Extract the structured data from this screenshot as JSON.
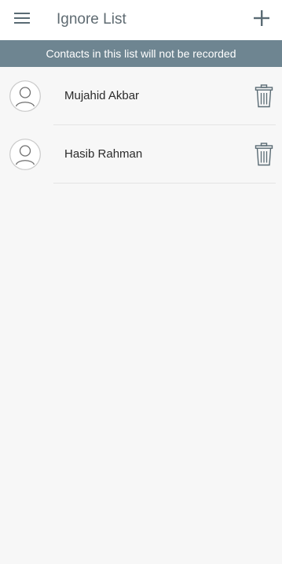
{
  "app_bar": {
    "title": "Ignore List",
    "menu_icon": "hamburger-menu-icon",
    "add_icon": "plus-icon"
  },
  "banner": {
    "text": "Contacts in this list will not be recorded"
  },
  "contacts": [
    {
      "name": "Mujahid Akbar",
      "avatar_icon": "person-avatar-icon",
      "delete_icon": "trash-icon"
    },
    {
      "name": "Hasib Rahman",
      "avatar_icon": "person-avatar-icon",
      "delete_icon": "trash-icon"
    }
  ],
  "colors": {
    "banner_background": "#6e8591",
    "title_text": "#5f6b72",
    "icon": "#5a6b74",
    "page_background": "#f7f7f7"
  }
}
